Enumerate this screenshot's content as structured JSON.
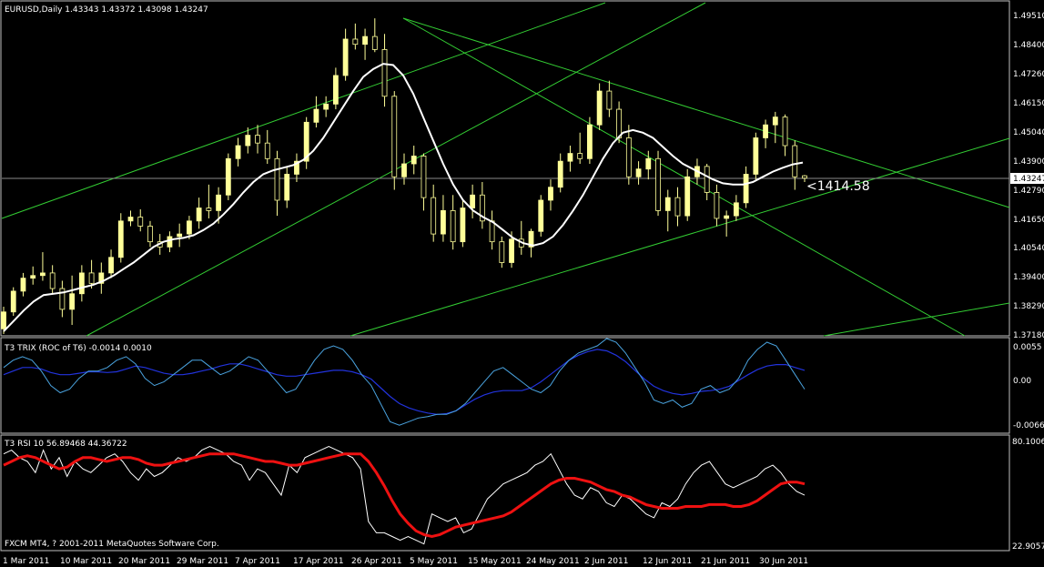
{
  "main": {
    "header": "EURUSD,Daily  1.43343 1.43372 1.43098 1.43247",
    "annotation": "<1414.58",
    "price_labels": [
      "1.49510",
      "1.48400",
      "1.47260",
      "1.46150",
      "1.45040",
      "1.43900",
      "1.42790",
      "1.41650",
      "1.40540",
      "1.39400",
      "1.38290",
      "1.37180"
    ],
    "current_price": "1.43247"
  },
  "trix": {
    "header": "T3 TRIX (ROC of T6) -0.0014 0.0010",
    "labels": [
      "0.0055",
      "0.00",
      "-0.0066"
    ]
  },
  "rsi": {
    "header": "T3 RSI 10 56.89468 44.36722",
    "labels": [
      "80.1006",
      "22.9057"
    ],
    "footer": "FXCM MT4, ? 2001-2011 MetaQuotes Software Corp."
  },
  "dates": [
    "1 Mar 2011",
    "10 Mar 2011",
    "20 Mar 2011",
    "29 Mar 2011",
    "7 Apr 2011",
    "17 Apr 2011",
    "26 Apr 2011",
    "5 May 2011",
    "15 May 2011",
    "24 May 2011",
    "2 Jun 2011",
    "12 Jun 2011",
    "21 Jun 2011",
    "30 Jun 2011"
  ],
  "colors": {
    "background": "#000000",
    "bull_candle": "#ffff99",
    "wick": "#ffff99",
    "trend_lines": "#33cc33",
    "moving_average": "#ffffff",
    "trix_fast": "#4aa3df",
    "trix_slow": "#2233dd",
    "rsi_fast": "#ffffff",
    "rsi_slow": "#ee1111",
    "border": "#c0c0c0"
  },
  "chart_data": {
    "type": "candlestick",
    "symbol": "EURUSD",
    "timeframe": "Daily",
    "ylim": [
      1.3718,
      1.4951
    ],
    "candles": [
      [
        1.3745,
        1.383,
        1.3725,
        1.381
      ],
      [
        1.381,
        1.3905,
        1.3795,
        1.389
      ],
      [
        1.389,
        1.396,
        1.387,
        1.394
      ],
      [
        1.394,
        1.3985,
        1.3915,
        1.395
      ],
      [
        1.395,
        1.404,
        1.393,
        1.396
      ],
      [
        1.396,
        1.399,
        1.388,
        1.39
      ],
      [
        1.39,
        1.393,
        1.379,
        1.382
      ],
      [
        1.382,
        1.395,
        1.376,
        1.388
      ],
      [
        1.388,
        1.399,
        1.385,
        1.396
      ],
      [
        1.396,
        1.401,
        1.39,
        1.392
      ],
      [
        1.392,
        1.4,
        1.388,
        1.396
      ],
      [
        1.396,
        1.405,
        1.394,
        1.402
      ],
      [
        1.402,
        1.419,
        1.4,
        1.416
      ],
      [
        1.416,
        1.42,
        1.414,
        1.4175
      ],
      [
        1.4175,
        1.4205,
        1.412,
        1.414
      ],
      [
        1.414,
        1.416,
        1.406,
        1.408
      ],
      [
        1.408,
        1.411,
        1.403,
        1.406
      ],
      [
        1.406,
        1.412,
        1.404,
        1.41
      ],
      [
        1.41,
        1.415,
        1.406,
        1.411
      ],
      [
        1.411,
        1.418,
        1.409,
        1.416
      ],
      [
        1.416,
        1.425,
        1.413,
        1.421
      ],
      [
        1.421,
        1.43,
        1.417,
        1.42
      ],
      [
        1.42,
        1.429,
        1.415,
        1.426
      ],
      [
        1.426,
        1.442,
        1.424,
        1.44
      ],
      [
        1.44,
        1.448,
        1.437,
        1.445
      ],
      [
        1.445,
        1.452,
        1.442,
        1.449
      ],
      [
        1.449,
        1.453,
        1.442,
        1.446
      ],
      [
        1.446,
        1.451,
        1.438,
        1.44
      ],
      [
        1.44,
        1.443,
        1.418,
        1.424
      ],
      [
        1.424,
        1.437,
        1.421,
        1.434
      ],
      [
        1.434,
        1.442,
        1.431,
        1.439
      ],
      [
        1.439,
        1.456,
        1.436,
        1.454
      ],
      [
        1.454,
        1.464,
        1.452,
        1.459
      ],
      [
        1.459,
        1.464,
        1.456,
        1.461
      ],
      [
        1.461,
        1.475,
        1.459,
        1.472
      ],
      [
        1.472,
        1.49,
        1.47,
        1.486
      ],
      [
        1.486,
        1.492,
        1.482,
        1.484
      ],
      [
        1.484,
        1.49,
        1.478,
        1.487
      ],
      [
        1.487,
        1.494,
        1.481,
        1.482
      ],
      [
        1.482,
        1.488,
        1.46,
        1.464
      ],
      [
        1.464,
        1.466,
        1.428,
        1.433
      ],
      [
        1.433,
        1.442,
        1.43,
        1.438
      ],
      [
        1.438,
        1.445,
        1.434,
        1.441
      ],
      [
        1.441,
        1.442,
        1.42,
        1.425
      ],
      [
        1.425,
        1.43,
        1.408,
        1.411
      ],
      [
        1.411,
        1.426,
        1.408,
        1.42
      ],
      [
        1.42,
        1.426,
        1.405,
        1.408
      ],
      [
        1.408,
        1.424,
        1.406,
        1.421
      ],
      [
        1.421,
        1.43,
        1.417,
        1.426
      ],
      [
        1.426,
        1.431,
        1.413,
        1.416
      ],
      [
        1.416,
        1.42,
        1.405,
        1.408
      ],
      [
        1.408,
        1.41,
        1.398,
        1.4
      ],
      [
        1.4,
        1.412,
        1.398,
        1.409
      ],
      [
        1.409,
        1.416,
        1.403,
        1.406
      ],
      [
        1.406,
        1.413,
        1.402,
        1.412
      ],
      [
        1.412,
        1.426,
        1.41,
        1.424
      ],
      [
        1.424,
        1.432,
        1.42,
        1.429
      ],
      [
        1.429,
        1.442,
        1.427,
        1.439
      ],
      [
        1.439,
        1.445,
        1.435,
        1.442
      ],
      [
        1.442,
        1.45,
        1.438,
        1.44
      ],
      [
        1.44,
        1.456,
        1.438,
        1.453
      ],
      [
        1.453,
        1.469,
        1.451,
        1.466
      ],
      [
        1.466,
        1.47,
        1.456,
        1.459
      ],
      [
        1.459,
        1.462,
        1.446,
        1.448
      ],
      [
        1.448,
        1.453,
        1.43,
        1.433
      ],
      [
        1.433,
        1.439,
        1.43,
        1.436
      ],
      [
        1.436,
        1.443,
        1.432,
        1.44
      ],
      [
        1.44,
        1.443,
        1.418,
        1.42
      ],
      [
        1.42,
        1.428,
        1.412,
        1.425
      ],
      [
        1.425,
        1.429,
        1.414,
        1.418
      ],
      [
        1.418,
        1.436,
        1.416,
        1.433
      ],
      [
        1.433,
        1.44,
        1.43,
        1.437
      ],
      [
        1.437,
        1.438,
        1.424,
        1.427
      ],
      [
        1.427,
        1.43,
        1.414,
        1.417
      ],
      [
        1.417,
        1.42,
        1.41,
        1.418
      ],
      [
        1.418,
        1.426,
        1.416,
        1.423
      ],
      [
        1.423,
        1.437,
        1.421,
        1.434
      ],
      [
        1.434,
        1.45,
        1.432,
        1.448
      ],
      [
        1.448,
        1.455,
        1.444,
        1.453
      ],
      [
        1.453,
        1.458,
        1.446,
        1.456
      ],
      [
        1.456,
        1.457,
        1.441,
        1.445
      ],
      [
        1.445,
        1.447,
        1.428,
        1.433
      ],
      [
        1.4334,
        1.4337,
        1.431,
        1.4325
      ]
    ],
    "moving_average": [
      1.3735,
      1.3775,
      1.3815,
      1.385,
      1.3875,
      1.388,
      1.3885,
      1.3895,
      1.3905,
      1.3915,
      1.393,
      1.395,
      1.3975,
      1.4,
      1.403,
      1.406,
      1.408,
      1.409,
      1.4095,
      1.4105,
      1.4125,
      1.415,
      1.4185,
      1.4225,
      1.427,
      1.431,
      1.434,
      1.4355,
      1.4365,
      1.4375,
      1.4395,
      1.443,
      1.448,
      1.454,
      1.46,
      1.466,
      1.4715,
      1.4745,
      1.4765,
      1.476,
      1.472,
      1.465,
      1.456,
      1.447,
      1.438,
      1.43,
      1.424,
      1.42,
      1.4175,
      1.4155,
      1.4125,
      1.4095,
      1.4075,
      1.4065,
      1.4075,
      1.41,
      1.4145,
      1.42,
      1.426,
      1.433,
      1.44,
      1.446,
      1.45,
      1.451,
      1.45,
      1.448,
      1.4445,
      1.441,
      1.438,
      1.436,
      1.434,
      1.432,
      1.4305,
      1.43,
      1.43,
      1.431,
      1.433,
      1.435,
      1.4365,
      1.4378,
      1.4385
    ],
    "trix": {
      "ylim": [
        -0.0066,
        0.0055
      ],
      "fast": [
        0.002,
        0.003,
        0.0035,
        0.003,
        0.0015,
        -0.0005,
        -0.0015,
        -0.001,
        0.0005,
        0.0015,
        0.0015,
        0.002,
        0.003,
        0.0035,
        0.0025,
        0.0005,
        -0.0005,
        0.0,
        0.001,
        0.002,
        0.003,
        0.003,
        0.002,
        0.001,
        0.0015,
        0.0025,
        0.0035,
        0.003,
        0.0015,
        0.0,
        -0.0015,
        -0.001,
        0.001,
        0.003,
        0.0045,
        0.005,
        0.0045,
        0.003,
        0.001,
        -0.0005,
        -0.003,
        -0.0055,
        -0.006,
        -0.0055,
        -0.005,
        -0.0048,
        -0.0045,
        -0.0045,
        -0.004,
        -0.003,
        -0.0015,
        0.0,
        0.0015,
        0.002,
        0.001,
        0.0,
        -0.001,
        -0.0015,
        -0.0005,
        0.0015,
        0.003,
        0.004,
        0.0045,
        0.005,
        0.006,
        0.0055,
        0.004,
        0.002,
        0.0,
        -0.0025,
        -0.003,
        -0.0025,
        -0.0035,
        -0.003,
        -0.001,
        -0.0005,
        -0.0015,
        -0.001,
        0.0005,
        0.003,
        0.0045,
        0.0055,
        0.005,
        0.003,
        0.001,
        -0.001
      ],
      "slow": [
        0.001,
        0.0015,
        0.002,
        0.002,
        0.0018,
        0.0013,
        0.001,
        0.001,
        0.0012,
        0.0014,
        0.0014,
        0.0013,
        0.0014,
        0.0018,
        0.0022,
        0.002,
        0.0016,
        0.0012,
        0.001,
        0.001,
        0.0012,
        0.0015,
        0.0018,
        0.0022,
        0.0025,
        0.0025,
        0.0022,
        0.0018,
        0.0014,
        0.001,
        0.0008,
        0.0008,
        0.001,
        0.0012,
        0.0014,
        0.0016,
        0.0016,
        0.0014,
        0.001,
        0.0004,
        -0.0008,
        -0.002,
        -0.003,
        -0.0036,
        -0.004,
        -0.0043,
        -0.0045,
        -0.0044,
        -0.004,
        -0.0032,
        -0.0024,
        -0.0018,
        -0.0014,
        -0.0012,
        -0.0012,
        -0.0012,
        -0.0008,
        0.0,
        0.001,
        0.002,
        0.003,
        0.0037,
        0.0042,
        0.0045,
        0.0043,
        0.0037,
        0.0028,
        0.0016,
        0.0004,
        -0.0006,
        -0.0012,
        -0.0016,
        -0.0018,
        -0.0016,
        -0.0013,
        -0.0012,
        -0.001,
        -0.0006,
        0.0002,
        0.001,
        0.0017,
        0.0022,
        0.0024,
        0.0024,
        0.002,
        0.0016
      ]
    },
    "rsi": {
      "ylim": [
        22.9057,
        80.1006
      ],
      "fast": [
        72,
        74,
        70,
        68,
        62,
        74,
        64,
        70,
        60,
        68,
        64,
        62,
        66,
        70,
        72,
        68,
        62,
        58,
        64,
        60,
        62,
        66,
        70,
        68,
        70,
        74,
        76,
        74,
        72,
        68,
        66,
        58,
        64,
        62,
        56,
        50,
        66,
        62,
        70,
        72,
        74,
        76,
        74,
        72,
        70,
        64,
        36,
        30,
        30,
        28,
        26,
        28,
        26,
        24,
        40,
        38,
        36,
        38,
        30,
        32,
        40,
        48,
        52,
        56,
        58,
        60,
        62,
        66,
        68,
        72,
        64,
        56,
        50,
        48,
        54,
        52,
        46,
        44,
        50,
        48,
        44,
        40,
        38,
        46,
        44,
        48,
        56,
        62,
        66,
        68,
        62,
        56,
        54,
        56,
        58,
        60,
        64,
        66,
        62,
        56,
        52,
        50
      ],
      "slow": [
        66,
        68,
        70,
        71,
        70,
        68,
        66,
        64,
        65,
        68,
        70,
        70,
        69,
        68,
        69,
        70,
        70,
        69,
        67,
        66,
        66,
        67,
        68,
        69,
        70,
        71,
        72,
        72,
        72,
        72,
        71,
        70,
        69,
        68,
        68,
        67,
        66,
        66,
        67,
        68,
        69,
        70,
        71,
        72,
        72,
        72,
        68,
        62,
        55,
        47,
        40,
        35,
        31,
        29,
        28,
        29,
        31,
        33,
        34,
        35,
        36,
        37,
        38,
        39,
        41,
        44,
        47,
        50,
        53,
        56,
        58,
        59,
        59,
        58,
        57,
        55,
        53,
        52,
        50,
        49,
        47,
        45,
        44,
        43,
        43,
        43,
        44,
        44,
        44,
        45,
        45,
        45,
        44,
        44,
        45,
        47,
        50,
        53,
        56,
        57,
        57,
        56
      ]
    }
  }
}
